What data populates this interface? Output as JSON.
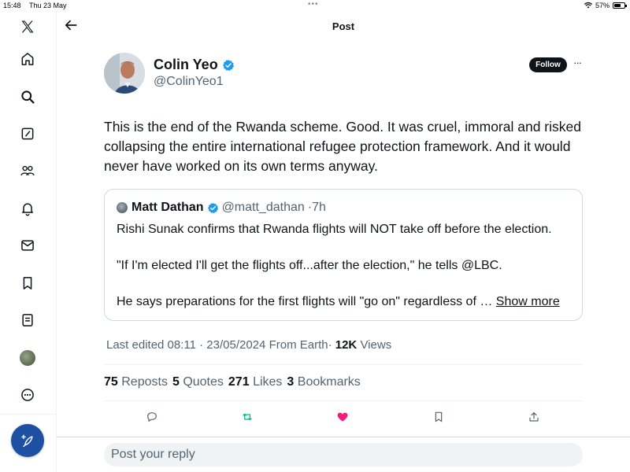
{
  "status_bar": {
    "time": "15:48",
    "date": "Thu 23 May",
    "battery": "57%",
    "battery_level": 0.57
  },
  "nav": {
    "items": [
      {
        "name": "x-logo-icon"
      },
      {
        "name": "home-icon"
      },
      {
        "name": "search-icon"
      },
      {
        "name": "grok-icon"
      },
      {
        "name": "communities-icon"
      },
      {
        "name": "notifications-icon"
      },
      {
        "name": "messages-icon"
      },
      {
        "name": "bookmarks-icon"
      },
      {
        "name": "lists-icon"
      },
      {
        "name": "profile-avatar"
      },
      {
        "name": "more-icon"
      }
    ],
    "compose_icon": "feather-plus-icon",
    "accent": "#1d4fa3"
  },
  "header": {
    "title": "Post",
    "back_icon": "arrow-left-icon"
  },
  "post": {
    "author_name": "Colin Yeo",
    "author_handle": "@ColinYeo1",
    "verified": true,
    "follow_label": "Follow",
    "more_label": "···",
    "text": "This is the end of the Rwanda scheme. Good. It was cruel, immoral and risked collapsing the entire international refugee protection framework. And it would never have worked on its own terms anyway.",
    "quote": {
      "author_name": "Matt Dathan",
      "author_handle": "@matt_dathan",
      "time": "·7h",
      "verified": true,
      "lines": [
        "Rishi Sunak confirms that Rwanda flights will NOT take off before the election.",
        "\"If I'm elected I'll get the flights off...after the election,\" he tells @LBC.",
        "He says preparations for the first flights will \"go on\" regardless of …"
      ],
      "show_more": "Show more"
    },
    "meta": {
      "edited": "Last edited 08:11 · 23/05/2024",
      "source": "From Earth",
      "separator": "·",
      "views_count": "12K",
      "views_label": "Views"
    },
    "stats": {
      "reposts_count": "75",
      "reposts_label": "Reposts",
      "quotes_count": "5",
      "quotes_label": "Quotes",
      "likes_count": "271",
      "likes_label": "Likes",
      "bookmarks_count": "3",
      "bookmarks_label": "Bookmarks"
    },
    "actions": {
      "reply_icon": "reply-icon",
      "repost_icon": "repost-icon",
      "like_icon": "heart-icon",
      "bookmark_icon": "bookmark-icon",
      "share_icon": "share-icon",
      "repost_color": "#00ba7c",
      "like_color": "#f91880"
    }
  },
  "reply": {
    "placeholder": "Post your reply"
  },
  "colors": {
    "verified_blue": "#1d9bf0",
    "secondary_text": "#536471"
  }
}
